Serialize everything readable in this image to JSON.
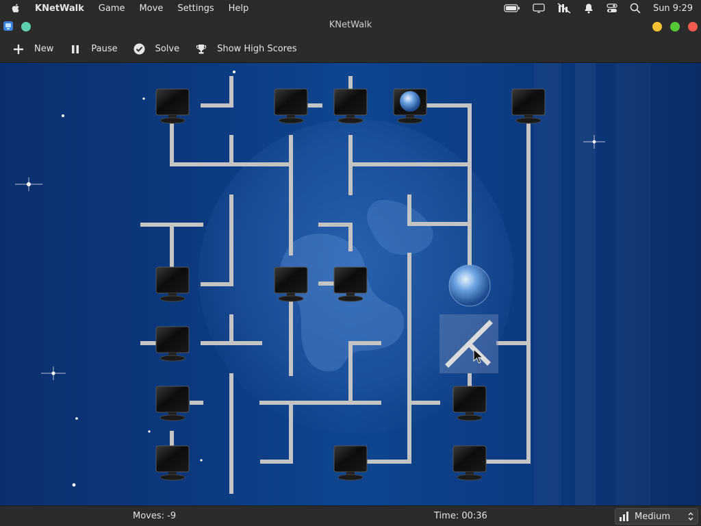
{
  "menubar": {
    "app_name": "KNetWalk",
    "menus": [
      "Game",
      "Move",
      "Settings",
      "Help"
    ],
    "clock": "Sun 9:29"
  },
  "window": {
    "title": "KNetWalk"
  },
  "toolbar": {
    "new_label": "New",
    "pause_label": "Pause",
    "solve_label": "Solve",
    "highscores_label": "Show High Scores"
  },
  "status": {
    "moves": "Moves: -9",
    "time": "Time: 00:36",
    "difficulty": "Medium"
  },
  "colors": {
    "board_bg": "#0c3a80",
    "pipe": "#c8c8c8",
    "selected_tile": "#6b86b8"
  }
}
